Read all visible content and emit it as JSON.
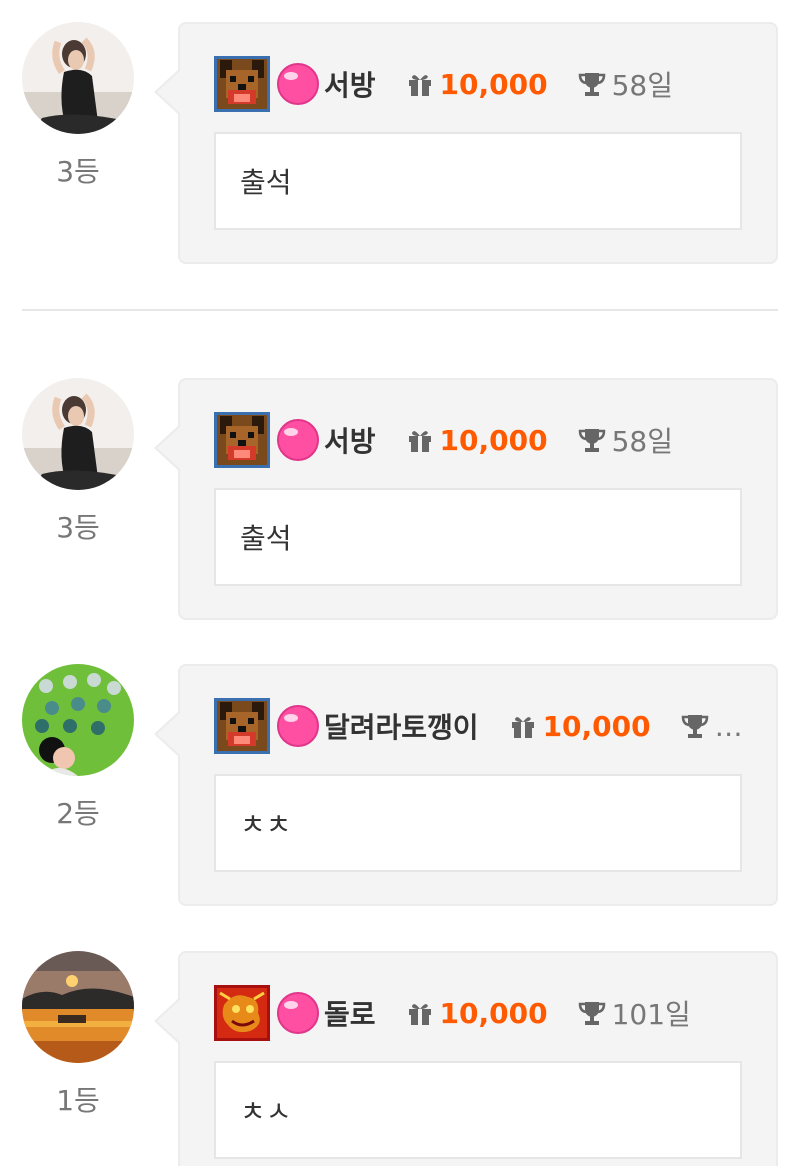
{
  "entries": [
    {
      "rank": "3등",
      "nickname": "서방",
      "points": "10,000",
      "days": "58일",
      "comment": "출석",
      "level_icon": "dog-badge-icon",
      "avatar": "avatar-woman-photo"
    },
    {
      "rank": "3등",
      "nickname": "서방",
      "points": "10,000",
      "days": "58일",
      "comment": "출석",
      "level_icon": "dog-badge-icon",
      "avatar": "avatar-woman-photo"
    },
    {
      "rank": "2등",
      "nickname": "달려라토깽이",
      "points": "10,000",
      "days": "…",
      "comment": "ㅊㅊ",
      "level_icon": "dog-badge-icon",
      "avatar": "avatar-cartoon-photo"
    },
    {
      "rank": "1등",
      "nickname": "돌로",
      "points": "10,000",
      "days": "101일",
      "comment": "ㅊㅅ",
      "level_icon": "dragon-badge-icon",
      "avatar": "avatar-sunset-photo"
    }
  ],
  "colors": {
    "points": "#ff5a00",
    "bubble_bg": "#f4f4f4",
    "gem": "#ff4fa3"
  }
}
